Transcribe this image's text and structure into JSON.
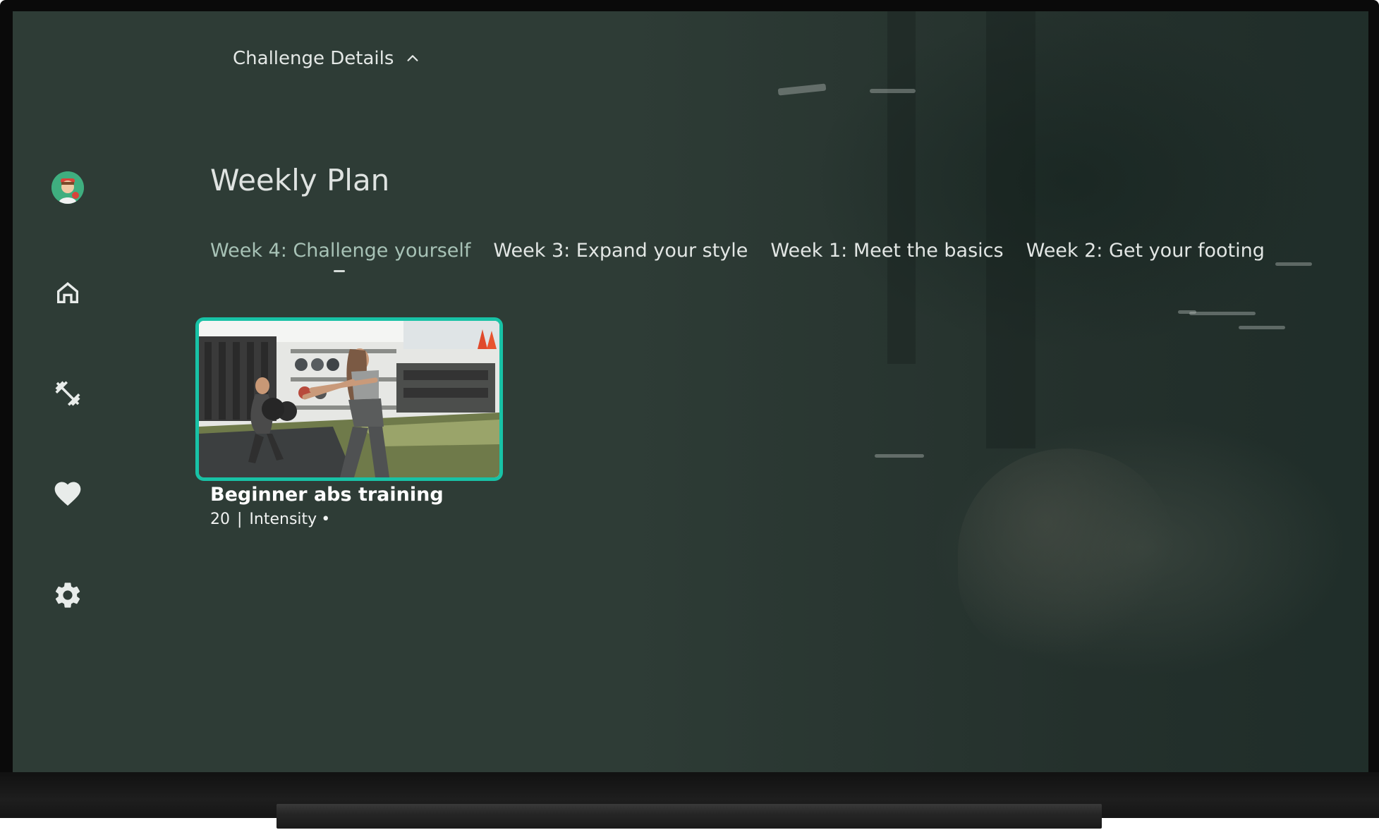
{
  "top_menu": {
    "label": "Challenge Details"
  },
  "page": {
    "title": "Weekly Plan"
  },
  "tabs": [
    {
      "label": "Week 4: Challenge yourself",
      "active": true
    },
    {
      "label": "Week 3: Expand your style",
      "active": false
    },
    {
      "label": "Week 1: Meet the basics",
      "active": false
    },
    {
      "label": "Week 2: Get your footing",
      "active": false
    }
  ],
  "sidebar": {
    "items": [
      {
        "icon": "avatar"
      },
      {
        "icon": "home-icon"
      },
      {
        "icon": "dumbbell-icon"
      },
      {
        "icon": "heart-icon"
      },
      {
        "icon": "gear-icon"
      }
    ]
  },
  "card": {
    "title": "Beginner abs training",
    "duration": "20",
    "separator": "|",
    "intensity_label": "Intensity",
    "intensity_dot": "•"
  },
  "colors": {
    "accent": "#18c2a6",
    "background": "#2e3c36",
    "active_tab": "#a7c2b6"
  }
}
